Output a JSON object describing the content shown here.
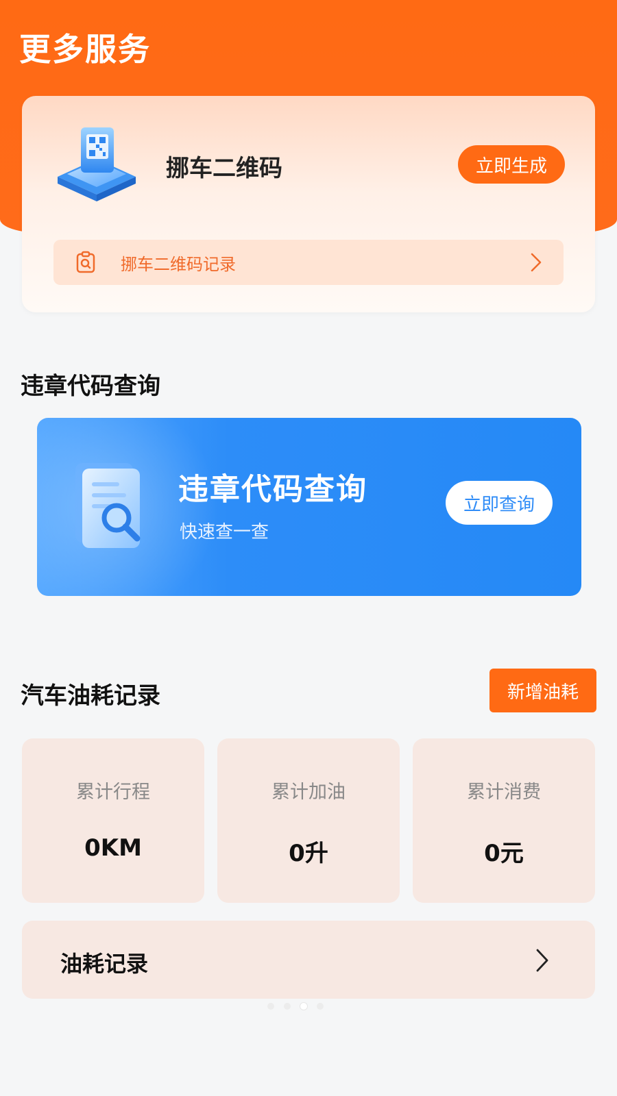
{
  "header": {
    "title": "更多服务"
  },
  "qr_card": {
    "icon": "qr-code-3d-icon",
    "title": "挪车二维码",
    "generate_label": "立即生成",
    "record_icon": "clipboard-icon",
    "record_label": "挪车二维码记录"
  },
  "violation": {
    "section_title": "违章代码查询",
    "banner_icon": "document-search-icon",
    "banner_title": "违章代码查询",
    "banner_subtitle": "快速查一查",
    "query_label": "立即查询"
  },
  "fuel": {
    "section_title": "汽车油耗记录",
    "add_label": "新增油耗",
    "stats": [
      {
        "label": "累计行程",
        "value": "0KM"
      },
      {
        "label": "累计加油",
        "value": "0升"
      },
      {
        "label": "累计消费",
        "value": "0元"
      }
    ],
    "record_label": "油耗记录"
  },
  "colors": {
    "brand_orange": "#ff6a14",
    "banner_blue": "#2589f6",
    "stat_bg": "#f7e8e2"
  }
}
